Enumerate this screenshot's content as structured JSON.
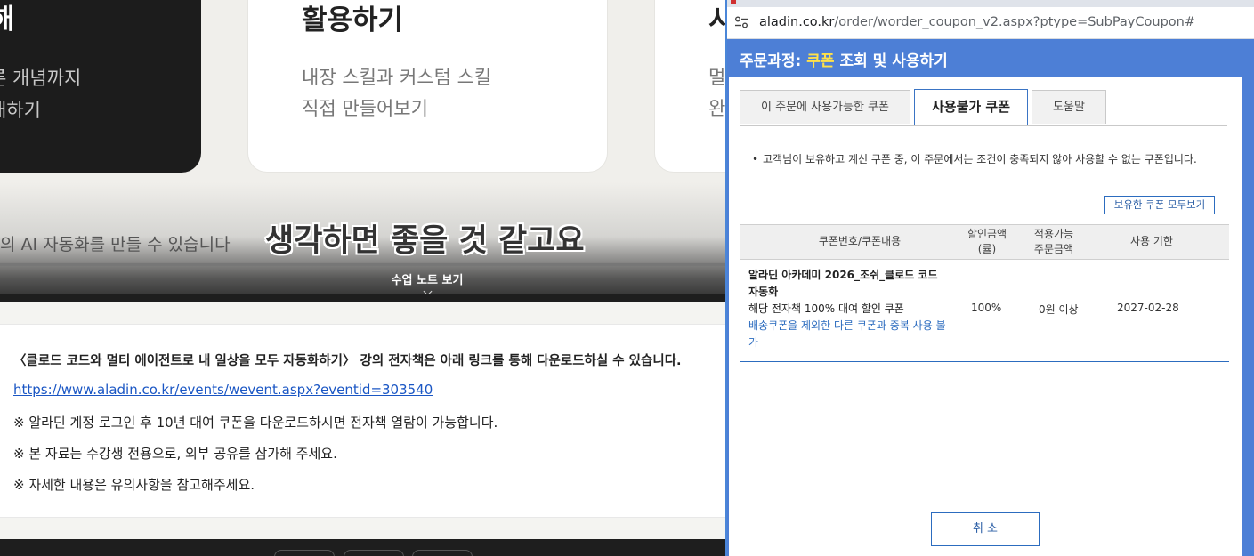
{
  "lecture": {
    "card_dark": {
      "title": "해",
      "line1": "른 개념까지",
      "line2": "대하기"
    },
    "card_mid": {
      "title": "활용하기",
      "line1": "내장 스킬과 커스텀 스킬",
      "line2": "직접 만들어보기"
    },
    "card_right": {
      "title": "시",
      "line1": "멀",
      "line2": "완"
    },
    "background_caption": "의 AI 자동화를 만들 수 있습니다",
    "subtitle": "생각하면 좋을 것 같고요",
    "note_toggle_label": "수업 노트 보기",
    "notes": {
      "heading": "〈클로드 코드와 멀티 에이전트로 내 일상을 모두 자동화하기〉 강의 전자책은 아래 링크를 통해 다운로드하실 수 있습니다.",
      "link": "https://www.aladin.co.kr/events/wevent.aspx?eventid=303540",
      "line1": "※ 알라딘 계정 로그인 후 10년 대여 쿠폰을 다운로드하시면 전자책 열람이 가능합니다.",
      "line2": "※ 본 자료는 수강생 전용으로, 외부 공유를 삼가해 주세요.",
      "line3": "※ 자세한 내용은 유의사항을 참고해주세요."
    }
  },
  "popup": {
    "address_bar": {
      "host": "aladin.co.kr",
      "path": "/order/worder_coupon_v2.aspx?ptype=SubPayCoupon#",
      "site_info_icon": "tune-icon"
    },
    "title_prefix": "주문과정: ",
    "title_highlight": "쿠폰",
    "title_suffix": " 조회 및 사용하기",
    "tabs": [
      {
        "label": "이 주문에 사용가능한 쿠폰",
        "active": false
      },
      {
        "label": "사용불가 쿠폰",
        "active": true
      },
      {
        "label": "도움말",
        "active": false
      }
    ],
    "notice_bullet": "•",
    "notice": "고객님이 보유하고 계신 쿠폰 중, 이 주문에서는 조건이 충족되지 않아 사용할 수 없는 쿠폰입니다.",
    "view_all_button": "보유한 쿠폰 모두보기",
    "table": {
      "headers": {
        "coupon": "쿠폰번호/쿠폰내용",
        "discount": [
          "할인금액",
          "(률)"
        ],
        "min_amount": [
          "적용가능",
          "주문금액"
        ],
        "expiry": "사용 기한"
      },
      "rows": [
        {
          "name": "알라딘 아카데미 2026_조쉬_클로드 코드 자동화",
          "description": "해당 전자책 100% 대여 할인 쿠폰",
          "restriction": "배송쿠폰을 제외한 다른 쿠폰과 중복 사용 불가",
          "discount": "100%",
          "min_amount": "0원 이상",
          "expiry": "2027-02-28"
        }
      ]
    },
    "cancel_button": "취 소",
    "colors": {
      "header_bg": "#4d7fd6",
      "highlight": "#ffe14a",
      "accent": "#2c6cbf"
    }
  }
}
